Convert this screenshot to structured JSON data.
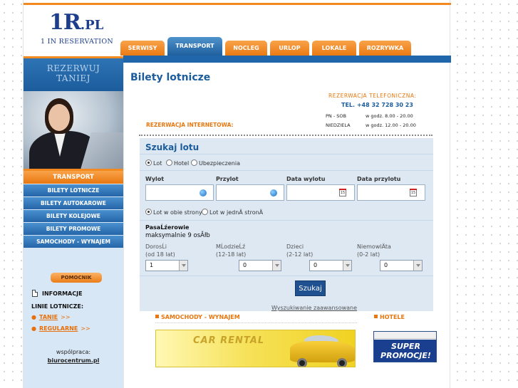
{
  "logo": {
    "main": "1R",
    "tld": ".PL",
    "tagline": "1 IN RESERVATION"
  },
  "tabs": [
    {
      "label": "SERWISY",
      "active": false
    },
    {
      "label": "TRANSPORT",
      "active": true
    },
    {
      "label": "NOCLEG",
      "active": false
    },
    {
      "label": "URLOP",
      "active": false
    },
    {
      "label": "LOKALE",
      "active": false
    },
    {
      "label": "ROZRYWKA",
      "active": false
    }
  ],
  "sidebar": {
    "banner_line1": "REZERWUJ",
    "banner_line2": "TANIEJ",
    "menu_head": "TRANSPORT",
    "items": [
      {
        "label": "BILETY LOTNICZE"
      },
      {
        "label": "BILETY AUTOKAROWE"
      },
      {
        "label": "BILETY KOLEJOWE"
      },
      {
        "label": "BILETY PROMOWE"
      },
      {
        "label": "SAMOCHODY - WYNAJEM"
      }
    ],
    "pomocnik": "POMOCNIK",
    "informacje": "INFORMACJE",
    "linie_title": "LINIE LOTNICZE:",
    "links": [
      {
        "label": "TANIE",
        "arrow": ">>"
      },
      {
        "label": "REGULARNE",
        "arrow": ">>"
      }
    ],
    "wspolpraca": "wspólpraca:",
    "partner": "biurocentrum.pl"
  },
  "main": {
    "title": "Bilety lotnicze",
    "rez_tel_label": "REZERWACJA TELEFONICZNA:",
    "tel": "TEL. +48 32 728 30 23",
    "hours": [
      {
        "days": "PN - SOB",
        "time": "w godz.   8.00 - 20.00"
      },
      {
        "days": "NIEDZIELA",
        "time": "w godz. 12.00 - 20.00"
      }
    ],
    "rez_int_label": "REZERWACJA INTERNETOWA:"
  },
  "search": {
    "title": "Szukaj lotu",
    "types": [
      {
        "label": "Lot",
        "checked": true
      },
      {
        "label": "Hotel",
        "checked": false
      },
      {
        "label": "Ubezpieczenia",
        "checked": false
      }
    ],
    "fields": [
      {
        "label": "Wylot",
        "value": "",
        "icon": "globe-icon"
      },
      {
        "label": "Przylot",
        "value": "",
        "icon": "globe-icon"
      },
      {
        "label": "Data wylotu",
        "value": "",
        "icon": "calendar-icon"
      },
      {
        "label": "Data przylotu",
        "value": "",
        "icon": "calendar-icon"
      }
    ],
    "calendar_glyph": "15",
    "trip": [
      {
        "label": "Lot w obie strony",
        "checked": true
      },
      {
        "label": "Lot w jednÄ stronÄ",
        "checked": false
      }
    ],
    "passengers_title": "PasaĹźerowie",
    "passengers_sub": "maksymalnie 9 osĂłb",
    "passengers": [
      {
        "label": "DorosĹi",
        "range": "(od 18 lat)",
        "value": "1"
      },
      {
        "label": "MĹodzieĹź",
        "range": "(12-18 lat)",
        "value": "0"
      },
      {
        "label": "Dzieci",
        "range": "(2-12 lat)",
        "value": "0"
      },
      {
        "label": "NiemowlÄta",
        "range": "(0-2 lat)",
        "value": "0"
      }
    ],
    "submit": "Szukaj",
    "advanced": "Wyszukiwanie zaawansowane"
  },
  "bottom": {
    "cars_title": "SAMOCHODY - WYNAJEM",
    "hotels_title": "HOTELE",
    "car_banner_text": "CAR RENTAL",
    "hotel_banner_line1": "SUPER",
    "hotel_banner_line2": "PROMOCJE!"
  },
  "colors": {
    "accent_orange": "#f28a1f",
    "brand_blue": "#1b5c9c",
    "panel_bg": "#dde8f3"
  }
}
